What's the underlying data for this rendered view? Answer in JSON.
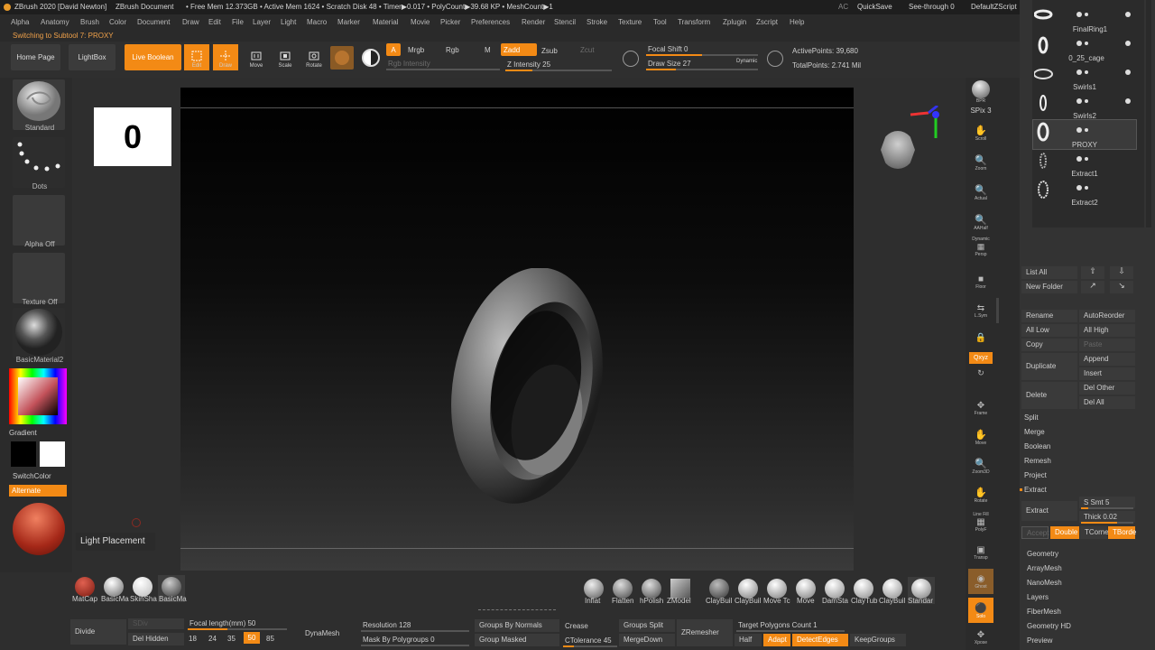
{
  "title_bar": {
    "app_title": "ZBrush 2020 [David Newton]",
    "document": "ZBrush Document",
    "stats": "• Free Mem 12.373GB • Active Mem 1624 • Scratch Disk 48 • Timer▶0.017 • PolyCount▶39.68 KP • MeshCount▶1",
    "ac": "AC",
    "quicksave": "QuickSave",
    "see_through": "See-through  0",
    "default_script": "DefaultZScript"
  },
  "menu": [
    "Alpha",
    "Anatomy",
    "Brush",
    "Color",
    "Document",
    "Draw",
    "Edit",
    "File",
    "Layer",
    "Light",
    "Macro",
    "Marker",
    "Material",
    "Movie",
    "Picker",
    "Preferences",
    "Render",
    "Stencil",
    "Stroke",
    "Texture",
    "Tool",
    "Transform",
    "Zplugin",
    "Zscript",
    "Help"
  ],
  "notice": "Switching to Subtool 7:  PROXY",
  "toolbar": {
    "home_page": "Home Page",
    "lightbox": "LightBox",
    "live_boolean": "Live Boolean",
    "edit": "Edit",
    "draw": "Draw",
    "move": "Move",
    "scale": "Scale",
    "rotate": "Rotate",
    "a": "A",
    "mrgb": "Mrgb",
    "rgb": "Rgb",
    "m": "M",
    "zadd": "Zadd",
    "zsub": "Zsub",
    "zcut": "Zcut",
    "rgb_intensity": "Rgb Intensity",
    "z_intensity": "Z Intensity 25",
    "focal_shift": "Focal Shift 0",
    "draw_size": "Draw Size 27",
    "dynamic": "Dynamic",
    "active_points": "ActivePoints: 39,680",
    "total_points": "TotalPoints: 2.741 Mil",
    "z_intensity_value": 25,
    "draw_size_value": 27
  },
  "left_panel": {
    "brush": "Standard",
    "stroke": "Dots",
    "alpha": "Alpha Off",
    "texture": "Texture Off",
    "material": "BasicMaterial2",
    "gradient": "Gradient",
    "switch_color": "SwitchColor",
    "alternate": "Alternate"
  },
  "canvas": {
    "counter": "0",
    "tooltip": "Light Placement"
  },
  "right_shelf": [
    "BPR",
    "SPix 3",
    "Scroll",
    "Zoom",
    "Actual",
    "AAHalf",
    "Dynamic",
    "Persp",
    "Floor",
    "L.Sym",
    "",
    "Qxyz",
    "",
    "Frame",
    "Move",
    "Zoom3D",
    "Rotate",
    "Line Fill",
    "PolyF",
    "Transp",
    "Ghost",
    "Solo",
    "Xpose"
  ],
  "subtools": [
    {
      "name": "FinalRing1"
    },
    {
      "name": "0_25_cage"
    },
    {
      "name": "Swirls1"
    },
    {
      "name": "Swirls2"
    },
    {
      "name": "PROXY"
    },
    {
      "name": "Extract1"
    },
    {
      "name": "Extract2"
    }
  ],
  "subtool_panel": {
    "list_all": "List All",
    "new_folder": "New Folder",
    "rename": "Rename",
    "auto_reorder": "AutoReorder",
    "all_low": "All Low",
    "all_high": "All High",
    "copy": "Copy",
    "paste": "Paste",
    "duplicate": "Duplicate",
    "append": "Append",
    "insert": "Insert",
    "delete": "Delete",
    "del_other": "Del Other",
    "del_all": "Del All",
    "split": "Split",
    "merge": "Merge",
    "boolean": "Boolean",
    "remesh": "Remesh",
    "project": "Project",
    "extract_header": "Extract",
    "extract": "Extract",
    "s_smt": "S Smt 5",
    "thick": "Thick 0.02",
    "accept": "Accept",
    "double": "Double",
    "tcorne": "TCorne",
    "tborde": "TBorde",
    "sections": [
      "Geometry",
      "ArrayMesh",
      "NanoMesh",
      "Layers",
      "FiberMesh",
      "Geometry HD",
      "Preview"
    ]
  },
  "materials": [
    "MatCap",
    "BasicMa",
    "SkinSha",
    "BasicMa"
  ],
  "brushes": [
    "Inflat",
    "Flatten",
    "hPolish",
    "ZModel",
    "ClayBuil",
    "ClayBuil",
    "Move Tc",
    "Move",
    "DamSta",
    "ClayTub",
    "ClayBuil",
    "Standar"
  ],
  "bottom": {
    "divide": "Divide",
    "sdiv": "SDiv",
    "focal_length": "Focal length(mm) 50",
    "del_hidden": "Del Hidden",
    "focal_presets": [
      "18",
      "24",
      "35",
      "50",
      "85"
    ],
    "dynamesh": "DynaMesh",
    "resolution": "Resolution 128",
    "mask_by_polygroups": "Mask By Polygroups 0",
    "groups_by_normals": "Groups By Normals",
    "group_masked": "Group Masked",
    "crease": "Crease",
    "ctolerance": "CTolerance 45",
    "groups_split": "Groups Split",
    "mergedown": "MergeDown",
    "zremesher": "ZRemesher",
    "target_polygons": "Target Polygons Count 1",
    "half": "Half",
    "adapt": "Adapt",
    "detect_edges": "DetectEdges",
    "keep_groups": "KeepGroups"
  },
  "colors": {
    "accent": "#f38a15",
    "panel": "#2b2b2b"
  }
}
